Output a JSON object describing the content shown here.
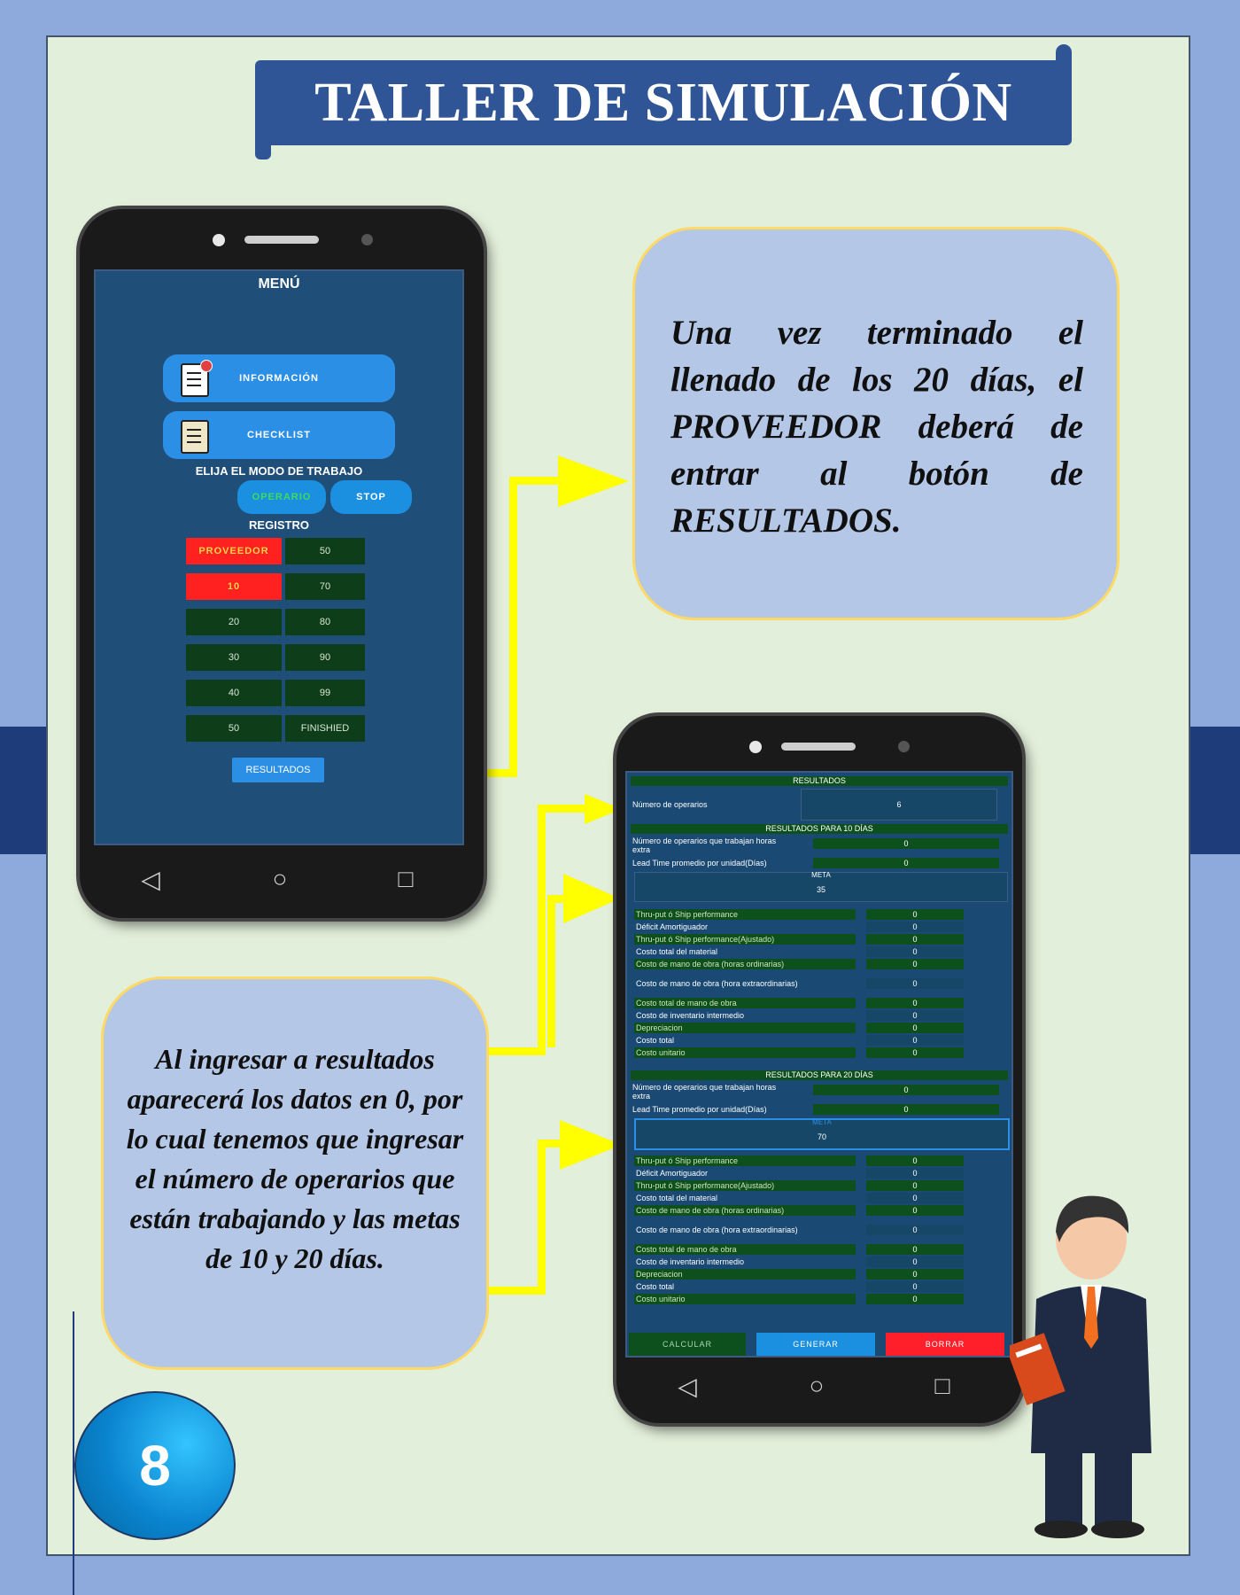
{
  "title": "TALLER DE SIMULACIÓN",
  "callout_top": "Una vez terminado el llenado de los 20 días, el PROVEEDOR deberá de entrar al botón de RESULTADOS.",
  "callout_bottom": "Al ingresar a resultados aparecerá los datos en 0, por lo cual tenemos que ingresar el número de operarios que están trabajando y las metas de 10 y 20 días.",
  "page_number": "8",
  "menu_phone": {
    "title": "MENÚ",
    "btn_info": "INFORMACIÓN",
    "btn_checklist": "CHECKLIST",
    "mode_label": "ELIJA EL MODO DE TRABAJO",
    "mode_operario": "OPERARIO",
    "mode_stop": "STOP",
    "registro_label": "REGISTRO",
    "grid": [
      [
        "PROVEEDOR",
        "50"
      ],
      [
        "10",
        "70"
      ],
      [
        "20",
        "80"
      ],
      [
        "30",
        "90"
      ],
      [
        "40",
        "99"
      ],
      [
        "50",
        "FINISHIED"
      ]
    ],
    "btn_resultados": "RESULTADOS",
    "nav": [
      "◁",
      "○",
      "□"
    ]
  },
  "results_phone": {
    "header": "RESULTADOS",
    "num_operarios_label": "Número de operarios",
    "num_operarios_value": "6",
    "section10": "RESULTADOS PARA 10 DÍAS",
    "section20": "RESULTADOS PARA 20 DÍAS",
    "ops_extra_label": "Número de operarios que trabajan horas extra",
    "lead_time_label": "Lead Time promedio por unidad(Días)",
    "meta_label": "META",
    "meta10_value": "35",
    "meta20_value": "70",
    "ops_extra_value": "0",
    "lead_time_value": "0",
    "metrics": [
      {
        "label": "Thru-put ó Ship performance",
        "value": "0"
      },
      {
        "label": "Déficit Amortiguador",
        "value": "0"
      },
      {
        "label": "Thru-put ó Ship performance(Ajustado)",
        "value": "0"
      },
      {
        "label": "Costo total del material",
        "value": "0"
      },
      {
        "label": "Costo de mano de obra (horas ordinarias)",
        "value": "0"
      },
      {
        "label": "Costo de mano de obra (hora extraordinarias)",
        "value": "0"
      },
      {
        "label": "Costo total de mano de obra",
        "value": "0"
      },
      {
        "label": "Costo de inventario intermedio",
        "value": "0"
      },
      {
        "label": "Depreciacion",
        "value": "0"
      },
      {
        "label": "Costo total",
        "value": "0"
      },
      {
        "label": "Costo unitario",
        "value": "0"
      }
    ],
    "btn_calcular": "CALCULAR",
    "btn_generar": "GENERAR",
    "btn_borrar": "BORRAR",
    "nav": [
      "◁",
      "○",
      "□"
    ]
  },
  "colors": {
    "highlight_arrow": "#ffff00",
    "title_bg": "#2f5597",
    "bubble_bg": "#b4c7e7",
    "bubble_border": "#ffd966"
  }
}
